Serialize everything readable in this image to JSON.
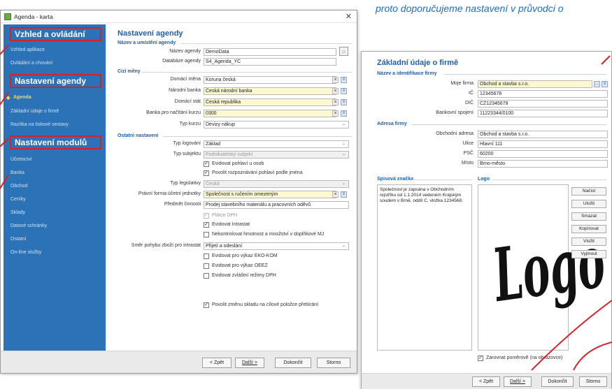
{
  "top_caption": "proto doporučujeme nastavení v průvodci o",
  "window1": {
    "title": "Agenda - karta",
    "sidebar": {
      "groups": [
        "Vzhled a ovládání",
        "Nastavení agendy",
        "Nastavení modulů"
      ],
      "items_group1": [
        "Vzhled aplikace",
        "Ovládání a chování"
      ],
      "items_group2": [
        "Agenda",
        "Základní údaje o firmě",
        "Razítka na tiskové sestavy"
      ],
      "items_group3": [
        "Účetnictví",
        "Banka",
        "Obchod",
        "Ceníky",
        "Sklady",
        "Datové schránky",
        "Ostatní",
        "On-line služby"
      ],
      "active_item": "Agenda",
      "colors": {
        "background": "#2b73b6",
        "highlight": "#d3232a",
        "active": "#ffd84a"
      }
    },
    "main": {
      "heading": "Nastavení agendy",
      "section_name": "Název a umístění agendy",
      "lbl_nazev": "Název agendy",
      "val_nazev": "DemoData",
      "lbl_databaze": "Databáze agendy",
      "val_databaze": "S4_Agenda_YC",
      "section_cizi": "Cizí měny",
      "lbl_domaci_mena": "Domácí měna",
      "val_domaci_mena": "Koruna česká",
      "lbl_narodni_banka": "Národní banka",
      "val_narodni_banka": "Česká národní banka",
      "lbl_domaci_stat": "Domácí stát",
      "val_domaci_stat": "Česká republika",
      "lbl_banka_kurz": "Banka pro načítání kurzu",
      "val_banka_kurz": "0300",
      "lbl_typ_kurzu": "Typ kurzu",
      "val_typ_kurzu": "Devizy nákup",
      "section_ostatni": "Ostatní nastavení",
      "lbl_typ_logovani": "Typ logování",
      "val_typ_logovani": "Základ",
      "lbl_typ_subjektu": "Typ subjektu",
      "val_typ_subjektu": "Podnikatelský subjekt",
      "cb_evidovat_pohlavi": "Evidovat pohlaví u osob",
      "cb_povolit_rozpoznavani": "Povolit rozpoznávání pohlaví podle jména",
      "lbl_typ_legislativy": "Typ legislativy",
      "val_typ_legislativy": "Česká",
      "lbl_pravni_forma": "Právní forma účetní jednotky",
      "val_pravni_forma": "Společnost s ručením omezeným",
      "lbl_predmet": "Předmět činnosti",
      "val_predmet": "Prodej stavebního materiálu a pracovních oděvů",
      "cb_platce_dph": "Plátce DPH",
      "cb_intrastat": "Evidovat Intrastat",
      "cb_nekontrolovat": "Nekontrolovat hmotnost a množství v doplňkové MJ",
      "lbl_smer_pohybu": "Směr pohybu zboží pro intrastat",
      "val_smer_pohybu": "Přijetí a odeslání",
      "cb_ekokom": "Evidovat pro výkaz EKO-KOM",
      "cb_oeez": "Evidovat pro výkaz OEEZ",
      "cb_zvlastni_dph": "Evidovat zvláštní režimy DPH",
      "cb_povolit_zmenu": "Povolit změnu skladu na cílové položce přebírání"
    },
    "footer": {
      "back": "< Zpět",
      "next": "Další >",
      "finish": "Dokončit",
      "cancel": "Storno"
    }
  },
  "window2": {
    "heading": "Základní údaje o firmě",
    "section_firm": "Název a identifikace firmy",
    "lbl_moje_firma": "Moje firma",
    "val_moje_firma": "Obchod a stavba s.r.o.",
    "lbl_ic": "IČ",
    "val_ic": "12345678",
    "lbl_dic": "DIČ",
    "val_dic": "CZ12345678",
    "lbl_bank": "Bankovní spojení",
    "val_bank": "11223344/0100",
    "section_address": "Adresa firmy",
    "lbl_obch_adresa": "Obchodní adresa",
    "val_obch_adresa": "Obchod a stavba s.r.o.",
    "lbl_ulice": "Ulice",
    "val_ulice": "Hlavní 111",
    "lbl_psc": "PSČ",
    "val_psc": "60200",
    "lbl_misto": "Místo",
    "val_misto": "Brno-město",
    "section_znacka": "Spisová značka",
    "znacka_text": "Společnost je zapsána v Obchodním rejstříku od 1.1.2014 vedeném Krajským soudem v Brně, oddíl C, vložka 1234568.",
    "section_logo": "Logo",
    "logo_word": "Logo",
    "logo_buttons": [
      "Načíst",
      "Uložit",
      "Smazat",
      "Kopírovat",
      "Vložit",
      "Vyjmout"
    ],
    "cb_zarovnat": "Zarovnat poměrově (na obrazovce)",
    "footer": {
      "back": "< Zpět",
      "next": "Další >",
      "finish": "Dokončit",
      "cancel": "Storno"
    }
  }
}
